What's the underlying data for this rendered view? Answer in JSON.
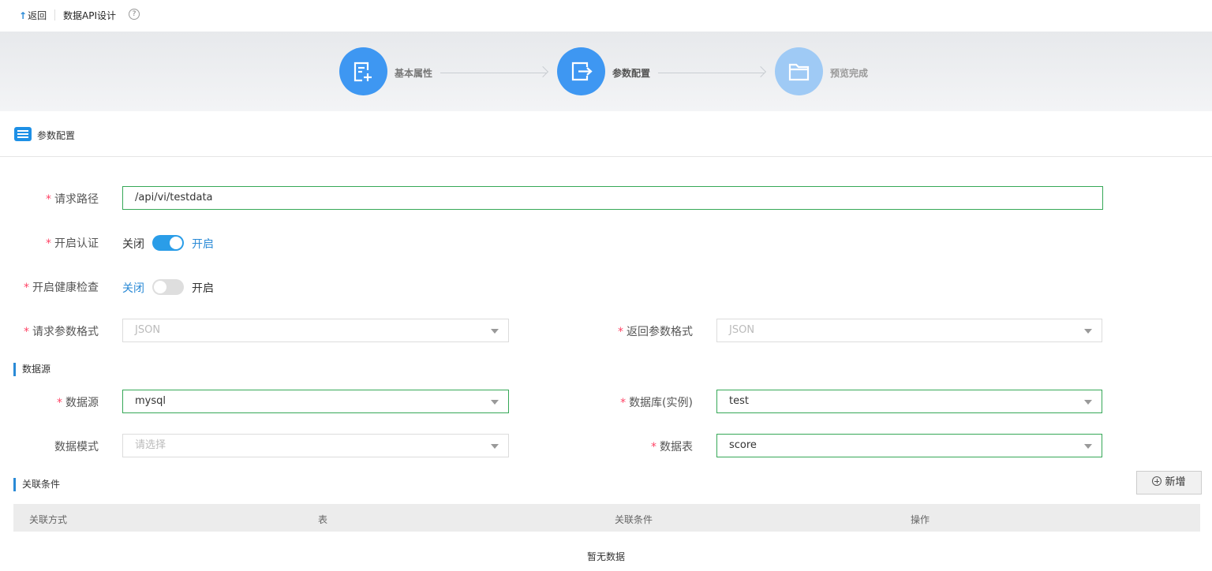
{
  "header": {
    "back": "返回",
    "title": "数据API设计",
    "help": "?"
  },
  "steps": [
    {
      "label": "基本属性",
      "icon": "edit-add-icon"
    },
    {
      "label": "参数配置",
      "icon": "exit-icon"
    },
    {
      "label": "预览完成",
      "icon": "folder-icon"
    }
  ],
  "section": {
    "title": "参数配置"
  },
  "form": {
    "path": {
      "label": "请求路径",
      "value": "/api/vi/testdata"
    },
    "auth": {
      "label": "开启认证",
      "off": "关闭",
      "on": "开启",
      "enabled": true
    },
    "health": {
      "label": "开启健康检查",
      "off": "关闭",
      "on": "开启",
      "enabled": false
    },
    "req_format": {
      "label": "请求参数格式",
      "value": "JSON"
    },
    "resp_format": {
      "label": "返回参数格式",
      "value": "JSON"
    }
  },
  "datasource": {
    "title": "数据源",
    "source": {
      "label": "数据源",
      "value": "mysql"
    },
    "database": {
      "label": "数据库(实例)",
      "value": "test"
    },
    "schema": {
      "label": "数据模式",
      "placeholder": "请选择"
    },
    "table": {
      "label": "数据表",
      "value": "score"
    }
  },
  "relations": {
    "title": "关联条件",
    "add": "新增",
    "columns": [
      "关联方式",
      "表",
      "关联条件",
      "操作"
    ],
    "empty": "暂无数据"
  },
  "colors": {
    "primary": "#3e97f2",
    "active_border": "#36a857",
    "link": "#2a8ad6",
    "required": "#ff4466"
  }
}
